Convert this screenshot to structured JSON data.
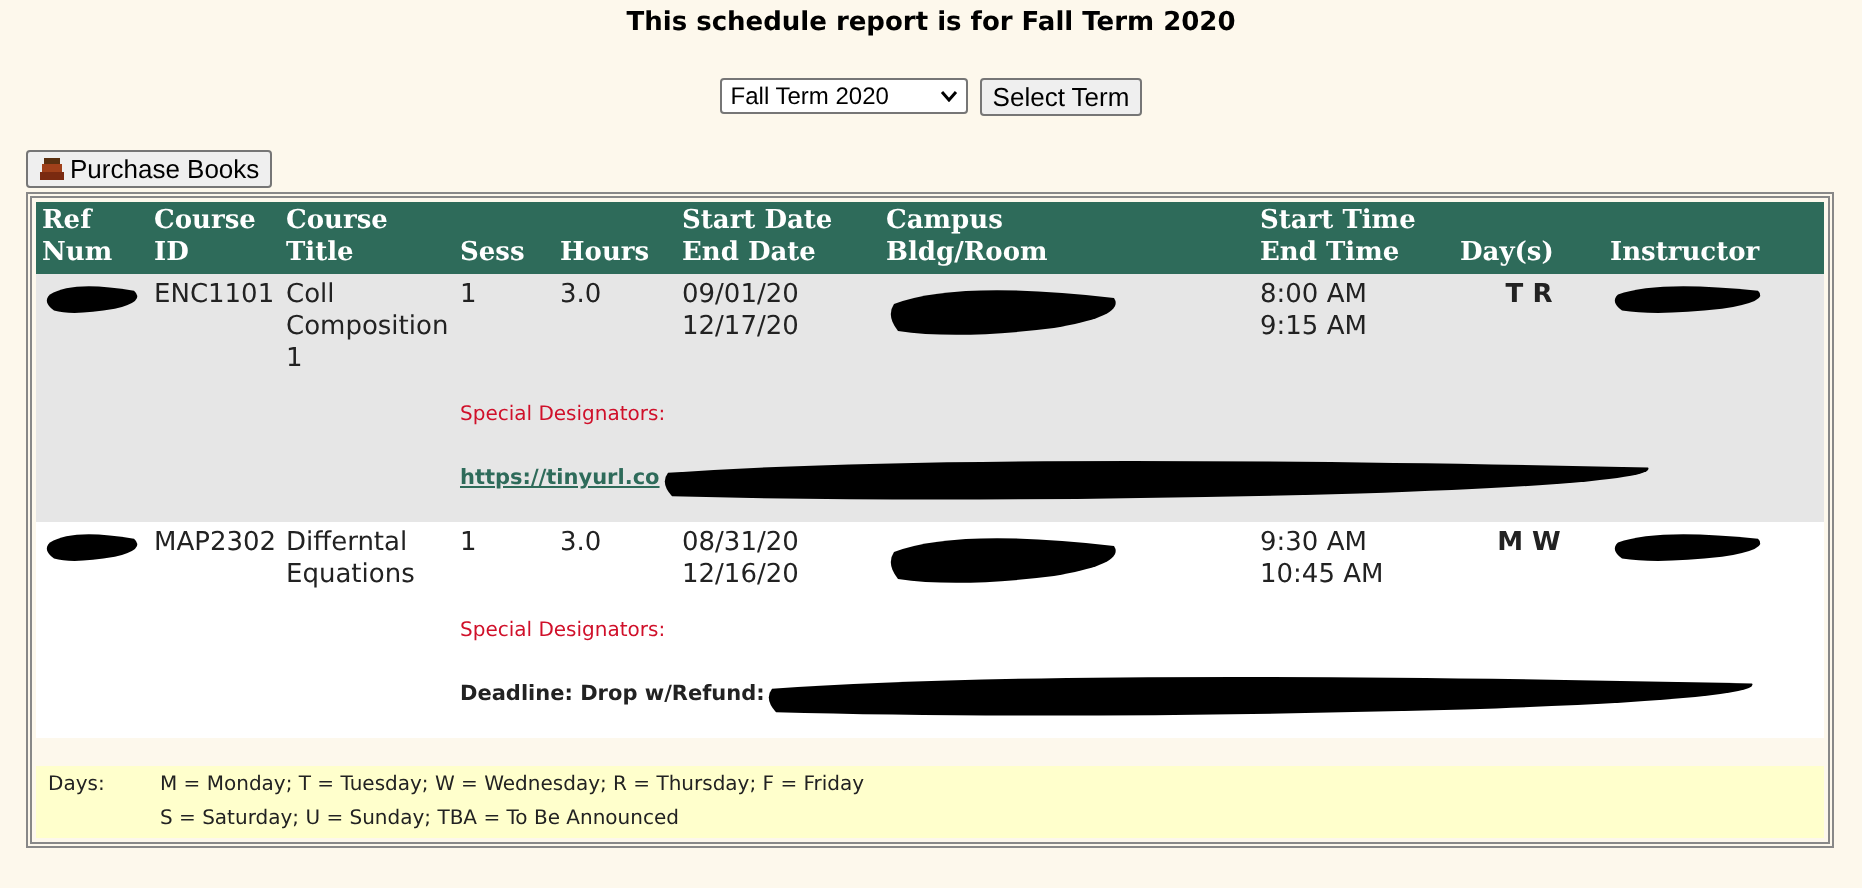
{
  "title": "This schedule report is for Fall Term 2020",
  "term_select": {
    "value": "Fall Term 2020"
  },
  "select_button": "Select Term",
  "purchase_button": "Purchase Books",
  "columns": [
    {
      "line1": "Ref",
      "line2": "Num"
    },
    {
      "line1": "Course",
      "line2": "ID"
    },
    {
      "line1": "Course",
      "line2": "Title"
    },
    {
      "line2": "Sess"
    },
    {
      "line2": "Hours"
    },
    {
      "line1": "Start Date",
      "line2": "End Date"
    },
    {
      "line1": "Campus",
      "line2": "Bldg/Room"
    },
    {
      "line1": "Start Time",
      "line2": "End Time"
    },
    {
      "line2": "Day(s)"
    },
    {
      "line2": "Instructor"
    }
  ],
  "rows": [
    {
      "course_id": "ENC1101",
      "title": "Coll Composition 1",
      "sess": "1",
      "hours": "3.0",
      "start_date": "09/01/20",
      "end_date": "12/17/20",
      "start_time": "8:00 AM",
      "end_time": "9:15 AM",
      "days": "T R",
      "designators": "Special Designators:",
      "note": {
        "kind": "link",
        "text": "https://tinyurl.co"
      },
      "redacted": true
    },
    {
      "course_id": "MAP2302",
      "title": "Differntal Equations",
      "sess": "1",
      "hours": "3.0",
      "start_date": "08/31/20",
      "end_date": "12/16/20",
      "start_time": "9:30 AM",
      "end_time": "10:45 AM",
      "days": "M W",
      "designators": "Special Designators:",
      "note": {
        "kind": "bold",
        "text": "Deadline: Drop w/Refund:"
      },
      "redacted": true
    }
  ],
  "legend": {
    "label": "Days:",
    "lines": [
      "M = Monday; T = Tuesday; W = Wednesday; R = Thursday; F = Friday",
      "S = Saturday; U = Sunday; TBA = To Be Announced"
    ]
  }
}
